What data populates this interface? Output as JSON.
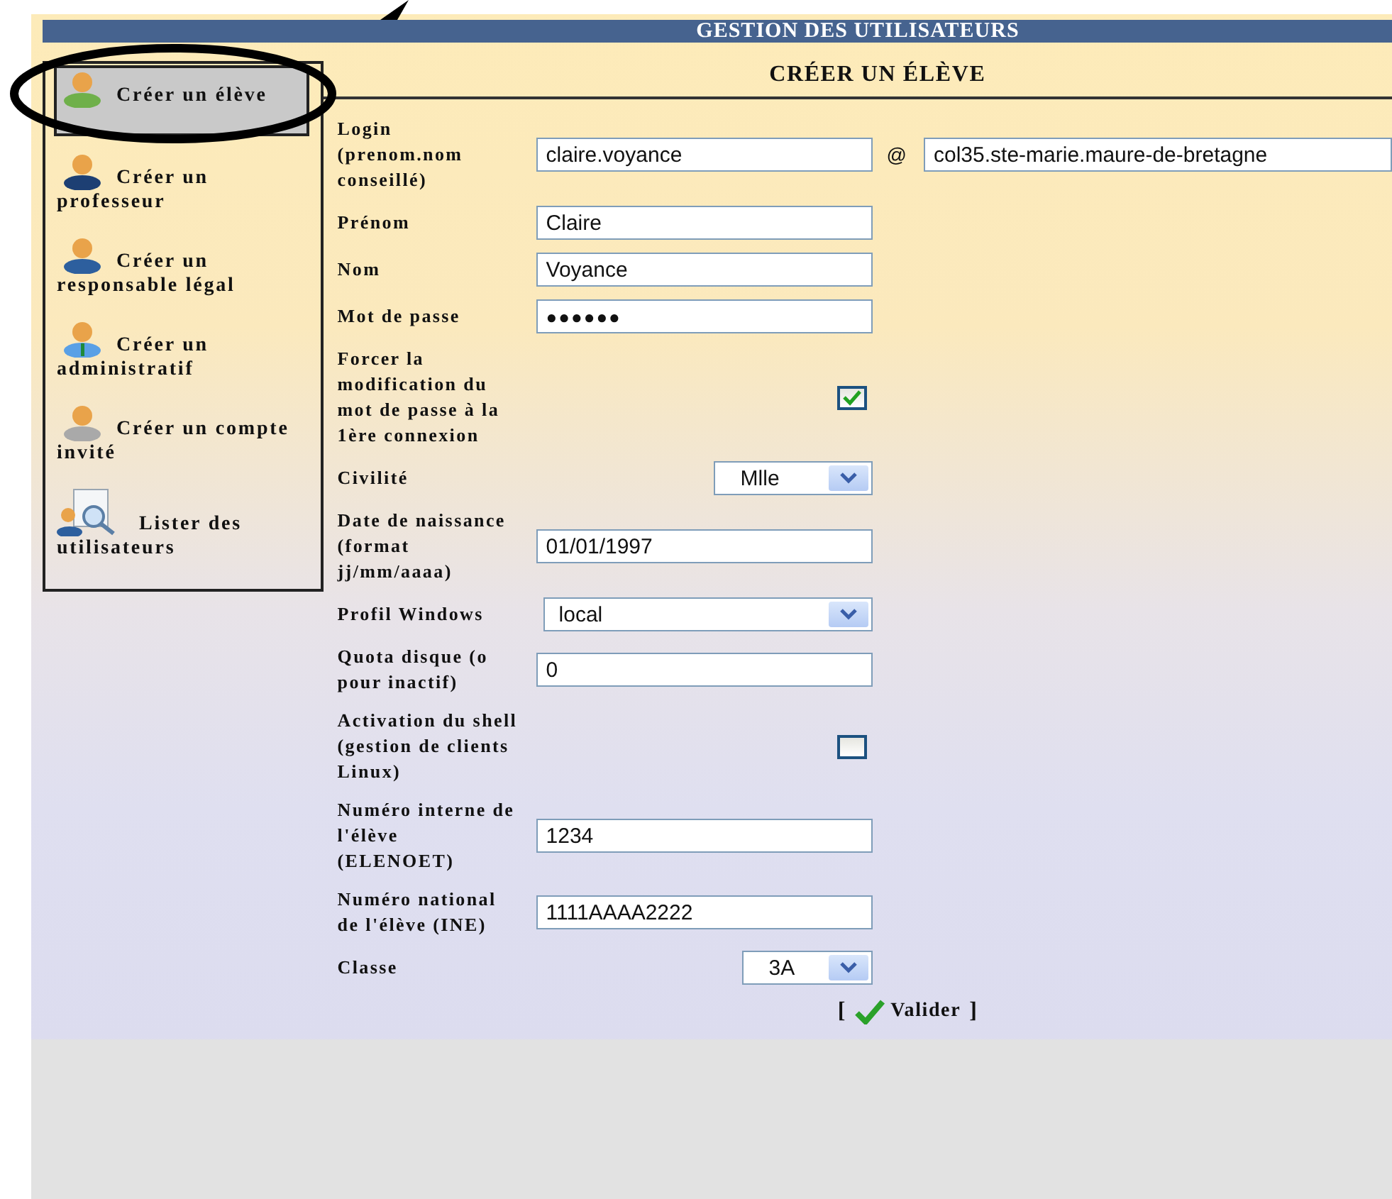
{
  "header": {
    "title": "GESTION DES UTILISATEURS"
  },
  "sidebar": {
    "items": [
      {
        "label": "Créer un élève",
        "selected": true
      },
      {
        "label": "Créer un professeur",
        "selected": false
      },
      {
        "label": "Créer un responsable légal",
        "selected": false
      },
      {
        "label": "Créer un administratif",
        "selected": false
      },
      {
        "label": "Créer un compte invité",
        "selected": false
      },
      {
        "label": "Lister des utilisateurs",
        "selected": false
      }
    ]
  },
  "form": {
    "title": "CRÉER UN ÉLÈVE",
    "fields": [
      {
        "kind": "login",
        "label": "Login (prenom.nom conseillé)",
        "value": "claire.voyance",
        "separator": "@",
        "domain": "col35.ste-marie.maure-de-bretagne"
      },
      {
        "kind": "text",
        "label": "Prénom",
        "value": "Claire"
      },
      {
        "kind": "text",
        "label": "Nom",
        "value": "Voyance"
      },
      {
        "kind": "password",
        "label": "Mot de passe",
        "value": "●●●●●●"
      },
      {
        "kind": "checkbox",
        "label": "Forcer la modification du mot de passe à la 1ère connexion",
        "checked": true
      },
      {
        "kind": "select",
        "label": "Civilité",
        "value": "Mlle"
      },
      {
        "kind": "text",
        "label": "Date de naissance (format jj/mm/aaaa)",
        "value": "01/01/1997"
      },
      {
        "kind": "select",
        "label": "Profil Windows",
        "value": "local"
      },
      {
        "kind": "text",
        "label": "Quota disque (o pour inactif)",
        "value": "0"
      },
      {
        "kind": "checkbox",
        "label": "Activation du shell (gestion de clients Linux)",
        "checked": false
      },
      {
        "kind": "text",
        "label": "Numéro interne de l'élève (ELENOET)",
        "value": "1234"
      },
      {
        "kind": "text",
        "label": "Numéro national de l'élève (INE)",
        "value": "1111AAAA2222"
      },
      {
        "kind": "select",
        "label": "Classe",
        "value": "3A"
      }
    ],
    "submit": {
      "open": "[",
      "label": "Valider",
      "close": "]"
    }
  }
}
